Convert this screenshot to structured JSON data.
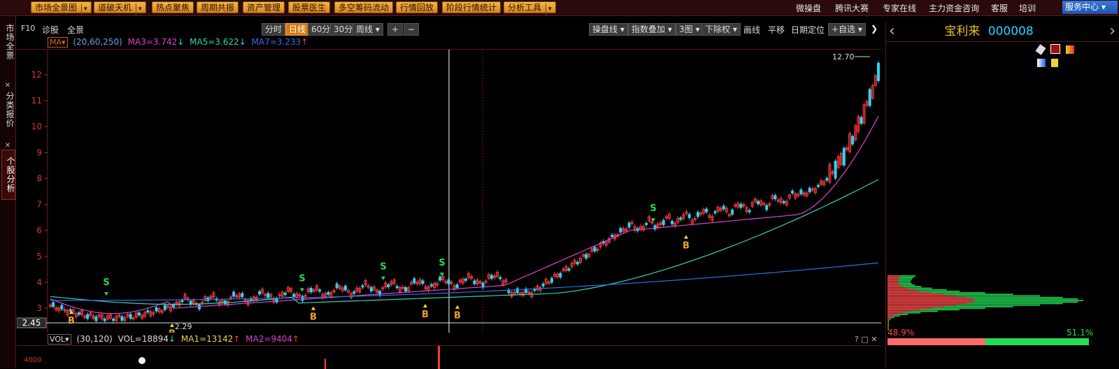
{
  "topbar": {
    "buttons": [
      {
        "label": "市场全景图",
        "dd": true
      },
      {
        "label": "道破天机",
        "dd": true
      },
      {
        "label": "热点聚焦",
        "dd": false
      },
      {
        "label": "周期共振",
        "dd": false
      },
      {
        "label": "资产管理",
        "dd": false
      },
      {
        "label": "股票医生",
        "dd": false
      },
      {
        "label": "多空筹码流动",
        "dd": false
      },
      {
        "label": "行情回放",
        "dd": false
      },
      {
        "label": "阶段行情统计",
        "dd": false
      },
      {
        "label": "分析工具",
        "dd": true
      }
    ],
    "links": [
      "微操盘",
      "腾讯大赛",
      "专家在线",
      "主力资金咨询",
      "客服",
      "培训"
    ],
    "service": "服务中心"
  },
  "leftnav": {
    "tab1": "市场全景",
    "tab2": "分类报价",
    "tab3": "个股分析",
    "close": "✕"
  },
  "toolbar": {
    "f10": "F10",
    "diag": "诊股",
    "full": "全景",
    "periods": [
      "分时",
      "日线",
      "60分",
      "30分",
      "周线"
    ],
    "active_period": "日线",
    "zoom_in": "+",
    "zoom_out": "−",
    "right": [
      "操盘线",
      "指数叠加",
      "3图",
      "下除权",
      "画线",
      "平移",
      "日期定位",
      "+自选"
    ]
  },
  "ma": {
    "btn": "MA",
    "params": "(20,60,250)",
    "ma3": "MA3=3.742",
    "ma5": "MA5=3.622",
    "ma7": "MA7=3.233",
    "arrow_down": "↓",
    "arrow_up": "↑"
  },
  "price_axis": {
    "labels": [
      "12",
      "11",
      "10",
      "9",
      "8",
      "7",
      "6",
      "5",
      "4",
      "3"
    ],
    "current": "2.45",
    "high": "12.70",
    "low": "2.29",
    "vol_tick": "4000"
  },
  "signals": {
    "buy": "B",
    "sell": "S"
  },
  "vol": {
    "btn": "VOL",
    "params": "(30,120)",
    "vol": "VOL=18894",
    "ma1": "MA1=13142",
    "ma2": "MA2=9404",
    "arrow_down": "↓",
    "arrow_up": "↑"
  },
  "panel_ctrl": "? □ ✕",
  "stock": {
    "name": "宝利来",
    "code": "000008",
    "nav_left": "‹",
    "nav_right": "›",
    "left_pct": "48.9%",
    "right_pct": "51.1%"
  },
  "colors": {
    "up": "#ff3b3b",
    "down": "#2ad3ff",
    "ma3": "#e040d0",
    "ma5": "#34d6b0",
    "ma7": "#2f6fe8",
    "accent": "#f0a030",
    "green": "#22dd55",
    "red": "#ff4a4a"
  }
}
